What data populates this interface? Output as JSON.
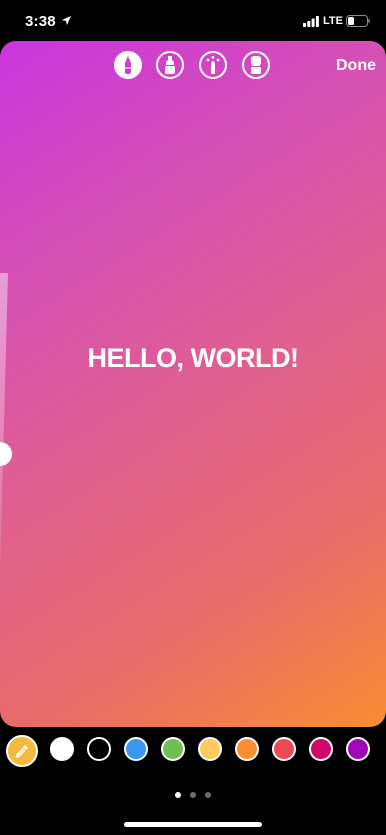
{
  "status_bar": {
    "time": "3:38",
    "network": "LTE",
    "icons": [
      "location-arrow-icon",
      "signal-bars-icon",
      "battery-icon"
    ]
  },
  "toolbar": {
    "tools": [
      {
        "name": "pen",
        "icon": "pen-icon",
        "selected": true
      },
      {
        "name": "marker",
        "icon": "marker-icon",
        "selected": false
      },
      {
        "name": "neon",
        "icon": "neon-pen-icon",
        "selected": false
      },
      {
        "name": "eraser",
        "icon": "eraser-icon",
        "selected": false
      }
    ],
    "done_label": "Done"
  },
  "canvas": {
    "text": "HELLO, WORLD!",
    "gradient_colors": [
      "#cb35df",
      "#e0608f",
      "#f88d32"
    ]
  },
  "palette": {
    "eyedropper_color": "#f5b93f",
    "colors": [
      "#ffffff",
      "#000000",
      "#3897f0",
      "#70c050",
      "#fdcb5c",
      "#fd8d32",
      "#ed4956",
      "#d10869",
      "#a307ba"
    ]
  },
  "pager": {
    "page_count": 3,
    "current_page": 1
  }
}
